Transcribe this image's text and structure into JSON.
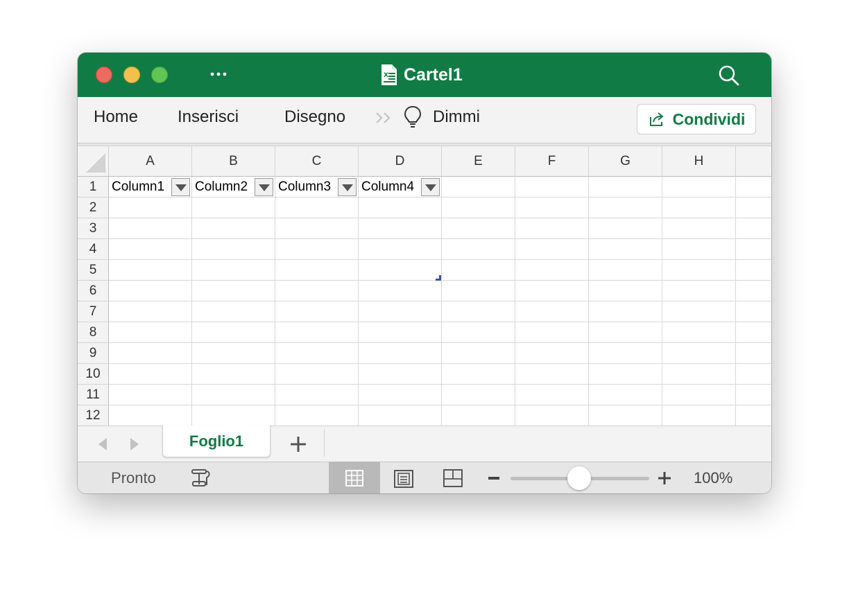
{
  "window": {
    "title": "Cartel1",
    "title_icon": "excel-document-icon",
    "more_icon": "ellipsis-icon",
    "search_icon": "search-icon"
  },
  "ribbon": {
    "tabs": [
      {
        "label": "Home"
      },
      {
        "label": "Inserisci"
      },
      {
        "label": "Disegno"
      }
    ],
    "overflow_icon": "double-chevron-right-icon",
    "tell_me_icon": "lightbulb-icon",
    "tell_me": "Dimmi",
    "share_label": "Condividi",
    "share_icon": "share-icon"
  },
  "sheet": {
    "columns": [
      "A",
      "B",
      "C",
      "D",
      "E",
      "F",
      "G",
      "H"
    ],
    "rows": [
      "1",
      "2",
      "3",
      "4",
      "5",
      "6",
      "7",
      "8",
      "9",
      "10",
      "11",
      "12"
    ],
    "header_cells": [
      "Column1",
      "Column2",
      "Column3",
      "Column4"
    ],
    "filter_icon": "filter-dropdown-icon"
  },
  "tabs": {
    "active_sheet": "Foglio1",
    "prev_icon": "chevron-left-icon",
    "next_icon": "chevron-right-icon",
    "add_icon": "plus-icon"
  },
  "status": {
    "text": "Pronto",
    "macro_icon": "macro-recording-icon",
    "views": [
      "normal-view-icon",
      "page-layout-view-icon",
      "page-break-view-icon"
    ],
    "zoom_level": "100%"
  },
  "colors": {
    "brand": "#117b45",
    "close": "#ed6a5e",
    "minimize": "#f5bf4f",
    "maximize": "#61c554"
  }
}
